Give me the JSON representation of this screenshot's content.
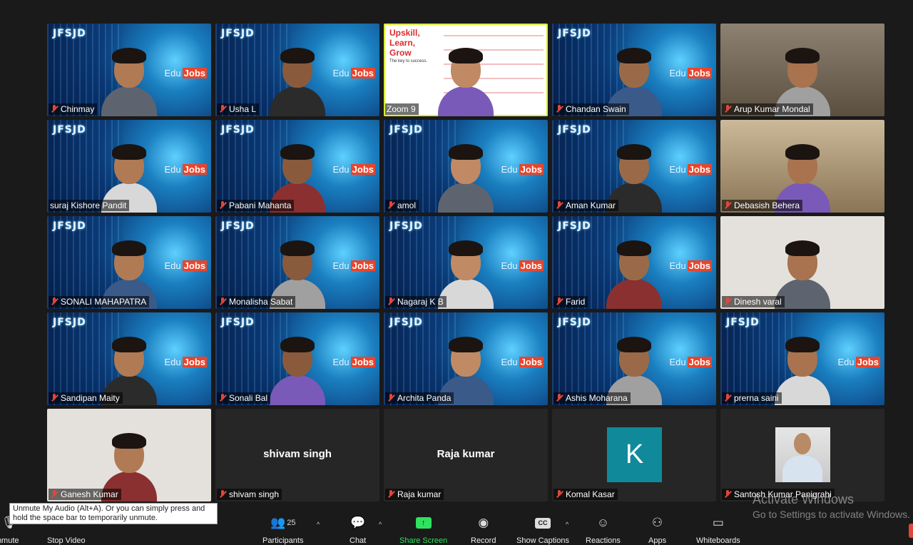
{
  "app": "Zoom Meeting",
  "brand_text": "JFSJD",
  "edujobs": {
    "edu": "Edu",
    "jobs": "Jobs"
  },
  "share_slide": {
    "headline": "Upskill, Learn, Grow",
    "sub": "The key to success."
  },
  "participants_grid": [
    {
      "name": "Chinmay",
      "muted": true,
      "kind": "video-branded"
    },
    {
      "name": "Usha L",
      "muted": true,
      "kind": "video-branded"
    },
    {
      "name": "Zoom 9",
      "muted": false,
      "kind": "share",
      "active_speaker": true
    },
    {
      "name": "Chandan Swain",
      "muted": true,
      "kind": "video-branded"
    },
    {
      "name": "Arup Kumar Mondal",
      "muted": true,
      "kind": "room"
    },
    {
      "name": "suraj Kishore Pandit",
      "muted": false,
      "kind": "video-branded"
    },
    {
      "name": "Pabani Mahanta",
      "muted": true,
      "kind": "video-branded"
    },
    {
      "name": "amol",
      "muted": true,
      "kind": "video-branded"
    },
    {
      "name": "Aman Kumar",
      "muted": true,
      "kind": "video-branded"
    },
    {
      "name": "Debasish Behera",
      "muted": true,
      "kind": "room2"
    },
    {
      "name": "SONALI MAHAPATRA",
      "muted": true,
      "kind": "video-branded"
    },
    {
      "name": "Monalisha Sabat",
      "muted": true,
      "kind": "video-branded"
    },
    {
      "name": "Nagaraj K B",
      "muted": true,
      "kind": "video-branded"
    },
    {
      "name": "Farid",
      "muted": true,
      "kind": "video-branded"
    },
    {
      "name": "Dinesh varal",
      "muted": true,
      "kind": "plain"
    },
    {
      "name": "Sandipan Maity",
      "muted": true,
      "kind": "video-branded"
    },
    {
      "name": "Sonali Bal",
      "muted": true,
      "kind": "video-branded"
    },
    {
      "name": "Archita Panda",
      "muted": true,
      "kind": "video-branded"
    },
    {
      "name": "Ashis Moharana",
      "muted": true,
      "kind": "video-branded"
    },
    {
      "name": "prerna saini",
      "muted": true,
      "kind": "video-branded"
    },
    {
      "name": "Ganesh Kumar",
      "muted": true,
      "kind": "plain"
    },
    {
      "name": "shivam singh",
      "muted": true,
      "kind": "no-video",
      "center_label": "shivam singh"
    },
    {
      "name": "Raja kumar",
      "muted": true,
      "kind": "no-video",
      "center_label": "Raja kumar"
    },
    {
      "name": "Komal Kasar",
      "muted": true,
      "kind": "avatar-letter",
      "avatar_letter": "K",
      "avatar_color": "#108a9a"
    },
    {
      "name": "Santosh Kumar Panigrahi",
      "muted": true,
      "kind": "avatar-photo"
    }
  ],
  "toolbar": {
    "unmute": "Unmute",
    "stop_video": "Stop Video",
    "participants": "Participants",
    "participants_count": "25",
    "chat": "Chat",
    "share_screen": "Share Screen",
    "record": "Record",
    "show_captions": "Show Captions",
    "reactions": "Reactions",
    "apps": "Apps",
    "whiteboards": "Whiteboards"
  },
  "tooltip": "Unmute My Audio (Alt+A). Or you can simply press and hold the space bar to temporarily unmute.",
  "watermark": {
    "line1": "Activate Windows",
    "line2": "Go to Settings to activate Windows."
  },
  "colors": {
    "muted_icon": "#e0473c",
    "share_green": "#2ee25e",
    "active_border": "#d6ee33"
  }
}
